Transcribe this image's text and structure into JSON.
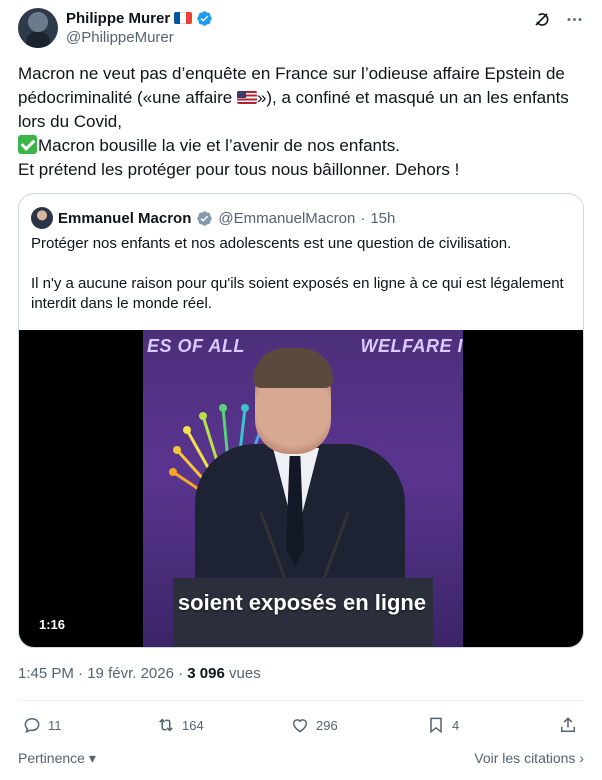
{
  "author": {
    "name": "Philippe Murer",
    "handle": "@PhilippeMurer",
    "flag_colors": [
      "#0055a4",
      "#ffffff",
      "#ef4135"
    ],
    "verified_color": "#1d9bf0"
  },
  "header_icons": [
    "grok-icon",
    "more-icon"
  ],
  "tweet": {
    "line1": "Macron ne veut pas d’enquête en France sur l’odieuse affaire Epstein de pédocriminalité («une affaire ",
    "line1_end": "»), a confiné et masqué un an les enfants lors du Covid,",
    "line2": "Macron bousille la vie et l’avenir de nos enfants.",
    "line3": "Et prétend les protéger pour tous nous bâillonner. Dehors !"
  },
  "quote": {
    "name": "Emmanuel Macron",
    "handle": "@EmmanuelMacron",
    "dot": "·",
    "time": "15h",
    "para1": "Protéger nos enfants et nos adolescents est une question de civilisation.",
    "para2": "Il n'y a aucune raison pour qu'ils soient exposés en ligne à ce qui est légalement interdit dans le monde réel.",
    "video": {
      "banner_left": "ES OF ALL",
      "banner_right": "WELFARE I",
      "caption": "soient exposés en ligne",
      "duration": "1:16"
    }
  },
  "meta": {
    "time": "1:45 PM",
    "sep1": "·",
    "date": "19 févr. 2026",
    "sep2": "·",
    "views_count": "3 096",
    "views_label": "vues"
  },
  "actions": {
    "replies": "11",
    "reposts": "164",
    "likes": "296",
    "bookmarks": "4"
  },
  "footer": {
    "sort_label": "Pertinence",
    "quotes_label": "Voir les citations"
  },
  "colors": {
    "text": "#0f1419",
    "secondary": "#536471",
    "border": "#cfd9de",
    "check_green": "#3bb54a"
  }
}
